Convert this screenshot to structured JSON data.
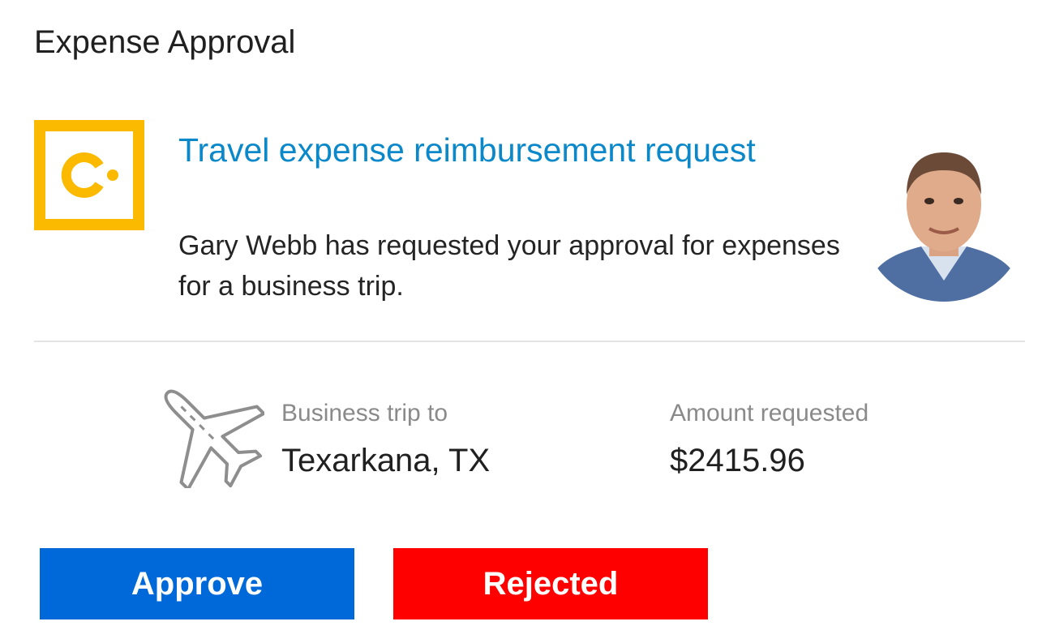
{
  "card": {
    "title": "Expense Approval"
  },
  "request": {
    "app_icon": "concur-logo-icon",
    "title": "Travel expense reimbursement request",
    "description": "Gary Webb has requested your approval for expenses for a business trip.",
    "requester_avatar": "requester-avatar"
  },
  "details": {
    "icon": "airplane-icon",
    "trip_label": "Business trip to",
    "trip_value": "Texarkana, TX",
    "amount_label": "Amount requested",
    "amount_value": "$2415.96"
  },
  "actions": {
    "approve_label": "Approve",
    "reject_label": "Rejected"
  },
  "colors": {
    "accent_link": "#0a88c9",
    "logo_yellow": "#fbb900",
    "approve_bg": "#0069d9",
    "reject_bg": "#ff0000",
    "label_gray": "#8a8a8a"
  }
}
